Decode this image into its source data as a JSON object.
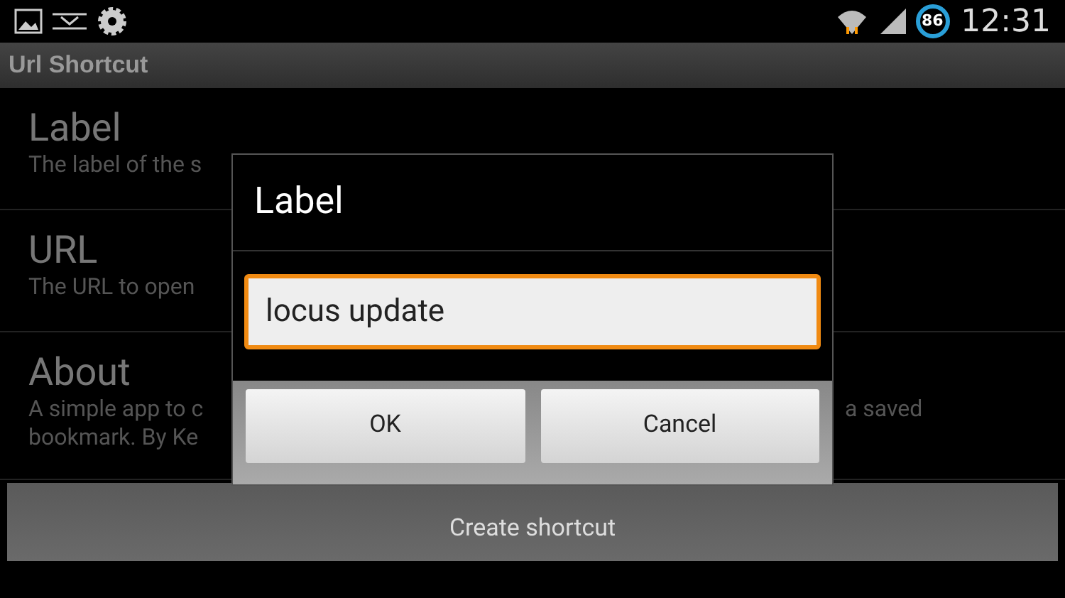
{
  "status_bar": {
    "battery": "86",
    "time": "12:31"
  },
  "app_bar": {
    "title": "Url Shortcut"
  },
  "settings": [
    {
      "title": "Label",
      "summary": [
        "The label of the s"
      ]
    },
    {
      "title": "URL",
      "summary": [
        "The URL to open"
      ]
    },
    {
      "title": "About",
      "summary": [
        "A simple app to c",
        "bookmark. By Ke"
      ],
      "summary_right": "a saved"
    }
  ],
  "create_button": "Create shortcut",
  "dialog": {
    "title": "Label",
    "value": "locus update",
    "buttons": [
      "OK",
      "Cancel"
    ]
  }
}
